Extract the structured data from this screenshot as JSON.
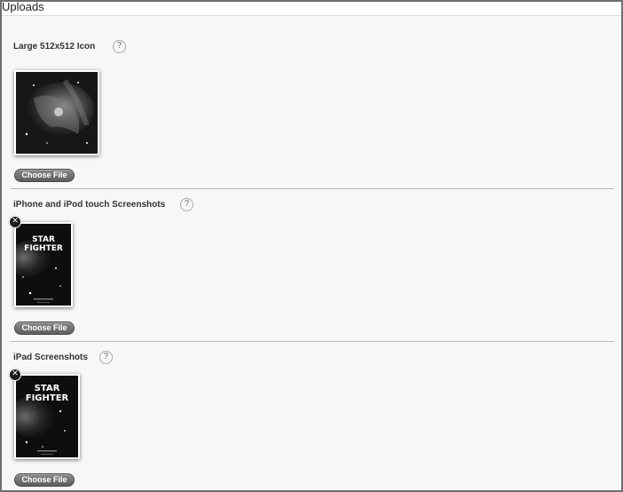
{
  "header": {
    "title": "Uploads"
  },
  "sections": [
    {
      "label": "Large 512x512 Icon",
      "help_glyph": "?",
      "button_label": "Choose File",
      "image_icon": "nebula-image"
    },
    {
      "label": "iPhone and iPod touch Screenshots",
      "help_glyph": "?",
      "button_label": "Choose File",
      "remove_glyph": "✕",
      "image_icon": "screenshot-image",
      "image_title_line1": "STAR",
      "image_title_line2": "FIGHTER"
    },
    {
      "label": "iPad Screenshots",
      "help_glyph": "?",
      "button_label": "Choose File",
      "remove_glyph": "✕",
      "image_icon": "screenshot-image",
      "image_title_line1": "STAR",
      "image_title_line2": "FIGHTER"
    }
  ]
}
